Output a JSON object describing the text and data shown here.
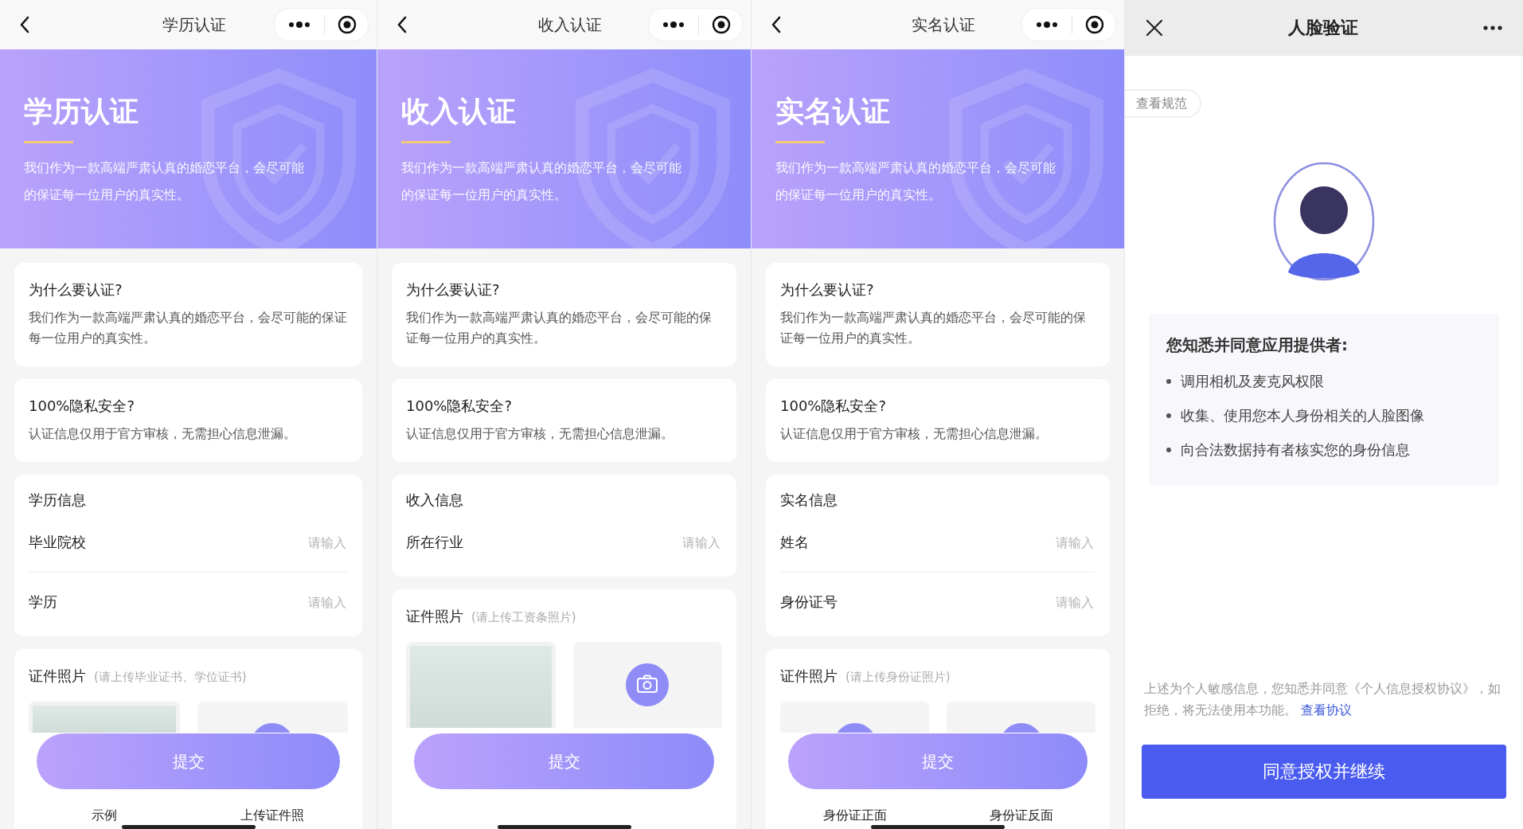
{
  "panels": [
    {
      "kind": "form",
      "nav_title": "学历认证",
      "banner": {
        "title": "学历认证",
        "text": "我们作为一款高端严肃认真的婚恋平台，会尽可能的保证每一位用户的真实性。"
      },
      "why": {
        "title": "为什么要认证?",
        "text": "我们作为一款高端严肃认真的婚恋平台，会尽可能的保证每一位用户的真实性。"
      },
      "privacy": {
        "title": "100%隐私安全?",
        "text": "认证信息仅用于官方审核，无需担心信息泄漏。"
      },
      "info": {
        "title": "学历信息",
        "fields": [
          {
            "label": "毕业院校",
            "placeholder": "请输入"
          },
          {
            "label": "学历",
            "placeholder": "请输入"
          }
        ]
      },
      "photos": {
        "title": "证件照片",
        "hint": "(请上传毕业证书、学位证书)",
        "slots": [
          {
            "kind": "sample",
            "caption": "示例"
          },
          {
            "kind": "upload",
            "caption": "上传证件照"
          }
        ]
      },
      "submit": "提交"
    },
    {
      "kind": "form",
      "nav_title": "收入认证",
      "banner": {
        "title": "收入认证",
        "text": "我们作为一款高端严肃认真的婚恋平台，会尽可能的保证每一位用户的真实性。"
      },
      "why": {
        "title": "为什么要认证?",
        "text": "我们作为一款高端严肃认真的婚恋平台，会尽可能的保证每一位用户的真实性。"
      },
      "privacy": {
        "title": "100%隐私安全?",
        "text": "认证信息仅用于官方审核，无需担心信息泄漏。"
      },
      "info": {
        "title": "收入信息",
        "fields": [
          {
            "label": "所在行业",
            "placeholder": "请输入"
          }
        ]
      },
      "photos": {
        "title": "证件照片",
        "hint": "(请上传工资条照片)",
        "slots": [
          {
            "kind": "sample"
          },
          {
            "kind": "upload"
          }
        ]
      },
      "submit": "提交"
    },
    {
      "kind": "form",
      "nav_title": "实名认证",
      "banner": {
        "title": "实名认证",
        "text": "我们作为一款高端严肃认真的婚恋平台，会尽可能的保证每一位用户的真实性。"
      },
      "why": {
        "title": "为什么要认证?",
        "text": "我们作为一款高端严肃认真的婚恋平台，会尽可能的保证每一位用户的真实性。"
      },
      "privacy": {
        "title": "100%隐私安全?",
        "text": "认证信息仅用于官方审核，无需担心信息泄漏。"
      },
      "info": {
        "title": "实名信息",
        "fields": [
          {
            "label": "姓名",
            "placeholder": "请输入"
          },
          {
            "label": "身份证号",
            "placeholder": "请输入"
          }
        ]
      },
      "photos": {
        "title": "证件照片",
        "hint": "(请上传身份证照片)",
        "slots": [
          {
            "kind": "upload",
            "caption": "身份证正面"
          },
          {
            "kind": "upload",
            "caption": "身份证反面"
          }
        ]
      },
      "submit": "提交"
    },
    {
      "kind": "face",
      "nav_title": "人脸验证",
      "spec_button": "查看规范",
      "consent_heading": "您知悉并同意应用提供者:",
      "bullets": [
        "调用相机及麦克风权限",
        "收集、使用您本人身份相关的人脸图像",
        "向合法数据持有者核实您的身份信息"
      ],
      "notice": "上述为个人敏感信息，您知悉并同意《个人信息授权协议》，如拒绝，将无法使用本功能。",
      "notice_link": "查看协议",
      "agree_button": "同意授权并继续"
    }
  ]
}
